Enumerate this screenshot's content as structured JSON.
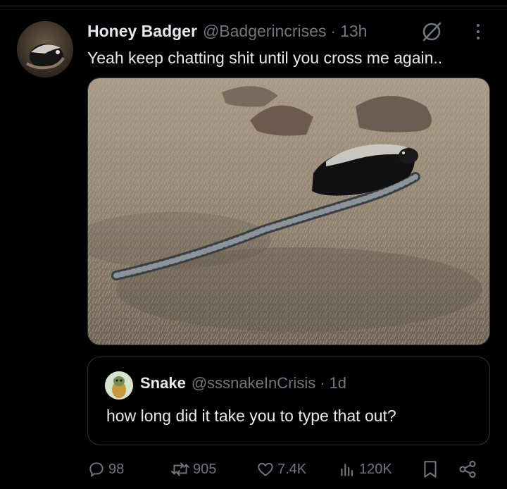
{
  "tweet": {
    "author_name": "Honey Badger",
    "author_handle": "@Badgerincrises",
    "separator": "·",
    "time": "13h",
    "text": "Yeah keep chatting shit until you cross me again.."
  },
  "quote": {
    "author_name": "Snake",
    "author_handle": "@sssnakeInCrisis",
    "separator": "·",
    "time": "1d",
    "text": "how long did it take you to type that out?"
  },
  "actions": {
    "replies": "98",
    "reposts": "905",
    "likes": "7.4K",
    "views": "120K"
  },
  "icons": {
    "grok": "grok-icon",
    "more": "more-icon",
    "reply": "reply-icon",
    "repost": "repost-icon",
    "like": "like-icon",
    "views": "views-icon",
    "bookmark": "bookmark-icon",
    "share": "share-icon"
  },
  "colors": {
    "background": "#000000",
    "text_primary": "#e7e9ea",
    "text_secondary": "#71767b",
    "border": "#2f3336"
  }
}
